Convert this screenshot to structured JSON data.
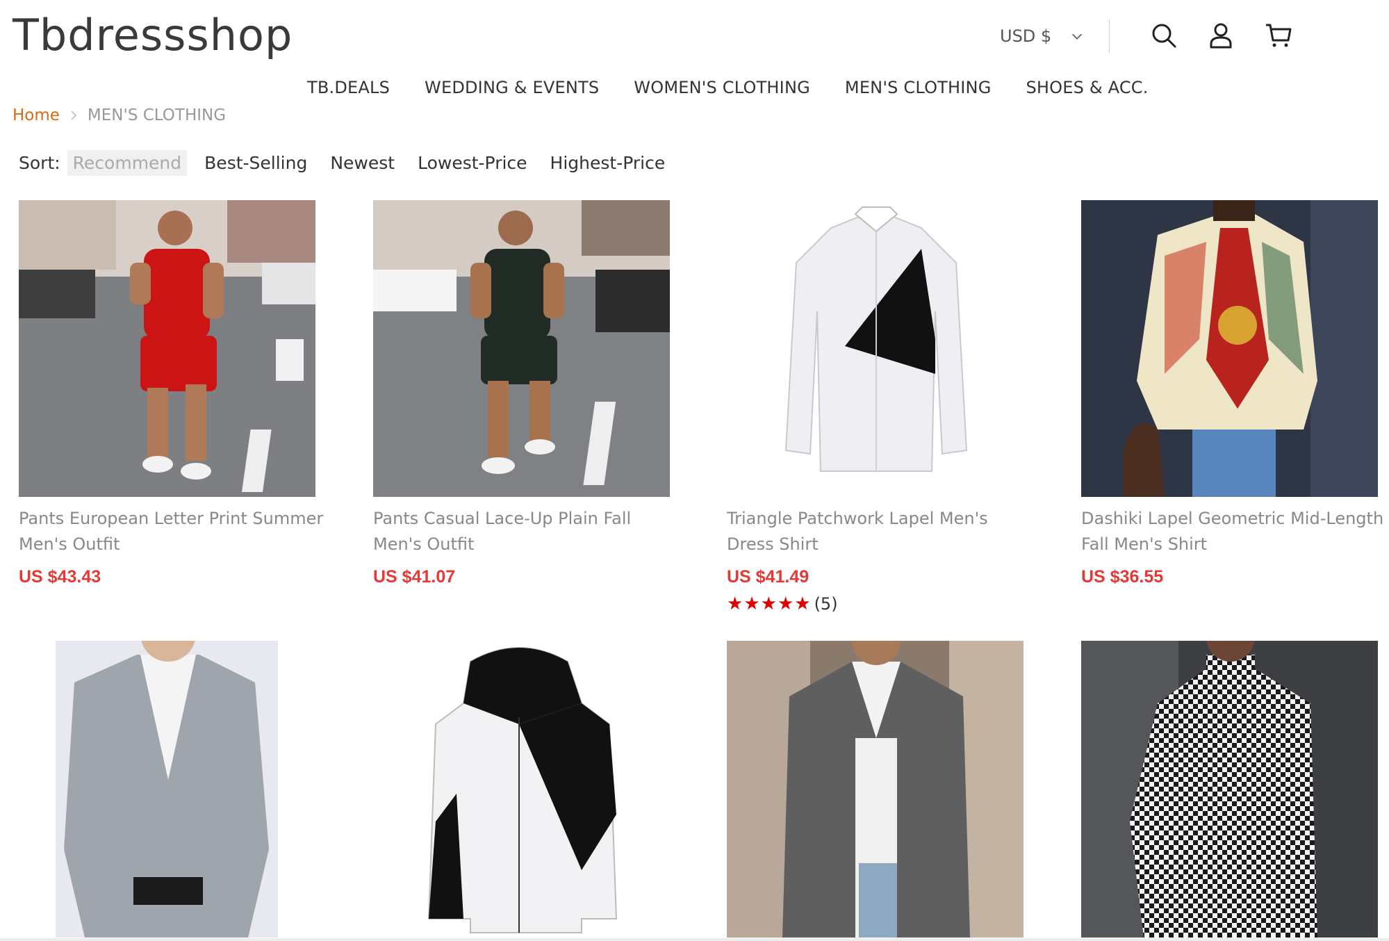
{
  "header": {
    "logo": "Tbdressshop",
    "currency": "USD $",
    "icons": [
      "search-icon",
      "user-icon",
      "cart-icon"
    ]
  },
  "nav": {
    "items": [
      "TB.DEALS",
      "WEDDING & EVENTS",
      "WOMEN'S CLOTHING",
      "MEN'S CLOTHING",
      "SHOES & ACC."
    ]
  },
  "breadcrumb": {
    "home": "Home",
    "current": "MEN'S CLOTHING"
  },
  "sort": {
    "label": "Sort:",
    "options": [
      "Recommend",
      "Best-Selling",
      "Newest",
      "Lowest-Price",
      "Highest-Price"
    ],
    "active": "Recommend"
  },
  "products": [
    {
      "name": "Pants European Letter Print Summer Men's Outfit",
      "price": "US $43.43"
    },
    {
      "name": "Pants Casual Lace-Up Plain Fall Men's Outfit",
      "price": "US $41.07"
    },
    {
      "name": "Triangle Patchwork Lapel Men's Dress Shirt",
      "price": "US $41.49",
      "rating": 5,
      "review_count": "(5)"
    },
    {
      "name": "Dashiki Lapel Geometric Mid-Length Fall Men's Shirt",
      "price": "US $36.55"
    },
    {
      "name": "",
      "price": ""
    },
    {
      "name": "",
      "price": ""
    },
    {
      "name": "",
      "price": ""
    },
    {
      "name": "",
      "price": ""
    }
  ],
  "colors": {
    "price": "#e53935",
    "breadcrumb_home": "#d96b14",
    "star": "#e30000"
  }
}
